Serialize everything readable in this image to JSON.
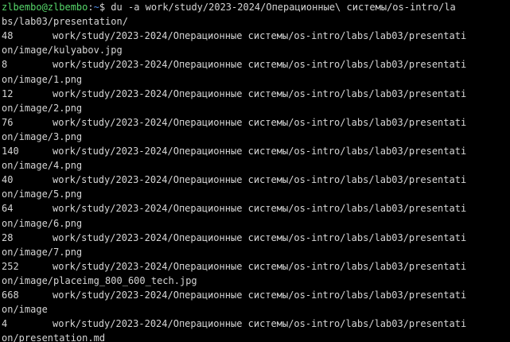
{
  "prompt": {
    "user_host": "zlbembo@zlbembo",
    "separator": ":",
    "path": "~",
    "symbol": "$ ",
    "command": "du -a work/study/2023-2024/Операционные\\ системы/os-intro/la"
  },
  "command_wrap": "bs/lab03/presentation/",
  "entries": [
    {
      "size": "48",
      "path": "work/study/2023-2024/Операционные системы/os-intro/labs/lab03/presentati",
      "wrap": "on/image/kulyabov.jpg"
    },
    {
      "size": "8",
      "path": "work/study/2023-2024/Операционные системы/os-intro/labs/lab03/presentati",
      "wrap": "on/image/1.png"
    },
    {
      "size": "12",
      "path": "work/study/2023-2024/Операционные системы/os-intro/labs/lab03/presentati",
      "wrap": "on/image/2.png"
    },
    {
      "size": "76",
      "path": "work/study/2023-2024/Операционные системы/os-intro/labs/lab03/presentati",
      "wrap": "on/image/3.png"
    },
    {
      "size": "140",
      "path": "work/study/2023-2024/Операционные системы/os-intro/labs/lab03/presentati",
      "wrap": "on/image/4.png"
    },
    {
      "size": "40",
      "path": "work/study/2023-2024/Операционные системы/os-intro/labs/lab03/presentati",
      "wrap": "on/image/5.png"
    },
    {
      "size": "64",
      "path": "work/study/2023-2024/Операционные системы/os-intro/labs/lab03/presentati",
      "wrap": "on/image/6.png"
    },
    {
      "size": "28",
      "path": "work/study/2023-2024/Операционные системы/os-intro/labs/lab03/presentati",
      "wrap": "on/image/7.png"
    },
    {
      "size": "252",
      "path": "work/study/2023-2024/Операционные системы/os-intro/labs/lab03/presentati",
      "wrap": "on/image/placeimg_800_600_tech.jpg"
    },
    {
      "size": "668",
      "path": "work/study/2023-2024/Операционные системы/os-intro/labs/lab03/presentati",
      "wrap": "on/image"
    },
    {
      "size": "4",
      "path": "work/study/2023-2024/Операционные системы/os-intro/labs/lab03/presentati",
      "wrap": "on/presentation.md"
    }
  ]
}
